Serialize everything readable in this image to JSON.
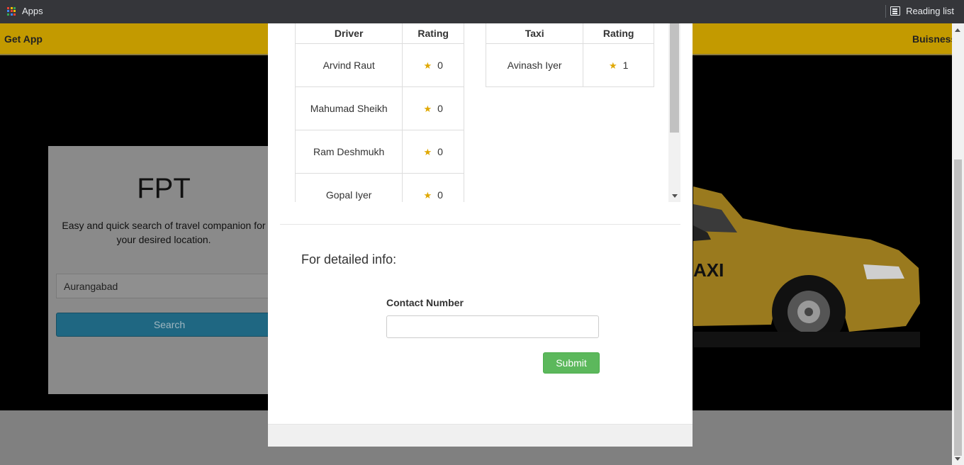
{
  "browser": {
    "apps_label": "Apps",
    "reading_list_label": "Reading list"
  },
  "site_nav": {
    "left_link": "Get App",
    "right_link": "Buisness"
  },
  "search_card": {
    "title": "FPT",
    "subtitle": "Easy and quick search of travel companion for your desired location.",
    "location_value": "Aurangabad",
    "search_label": "Search"
  },
  "taxi_sign": "AXI",
  "drivers_table": {
    "headers": [
      "Driver",
      "Rating"
    ],
    "rows": [
      {
        "name": "Arvind Raut",
        "rating": "0"
      },
      {
        "name": "Mahumad Sheikh",
        "rating": "0"
      },
      {
        "name": "Ram Deshmukh",
        "rating": "0"
      },
      {
        "name": "Gopal Iyer",
        "rating": "0"
      }
    ]
  },
  "taxi_table": {
    "headers": [
      "Taxi",
      "Rating"
    ],
    "rows": [
      {
        "name": "Avinash Iyer",
        "rating": "1"
      }
    ]
  },
  "detail": {
    "heading": "For detailed info:",
    "contact_label": "Contact Number",
    "contact_value": "",
    "submit_label": "Submit"
  },
  "colors": {
    "accent": "#f5c200",
    "submit": "#5cb85c",
    "search": "#31b0d5",
    "star": "#e0a800"
  }
}
